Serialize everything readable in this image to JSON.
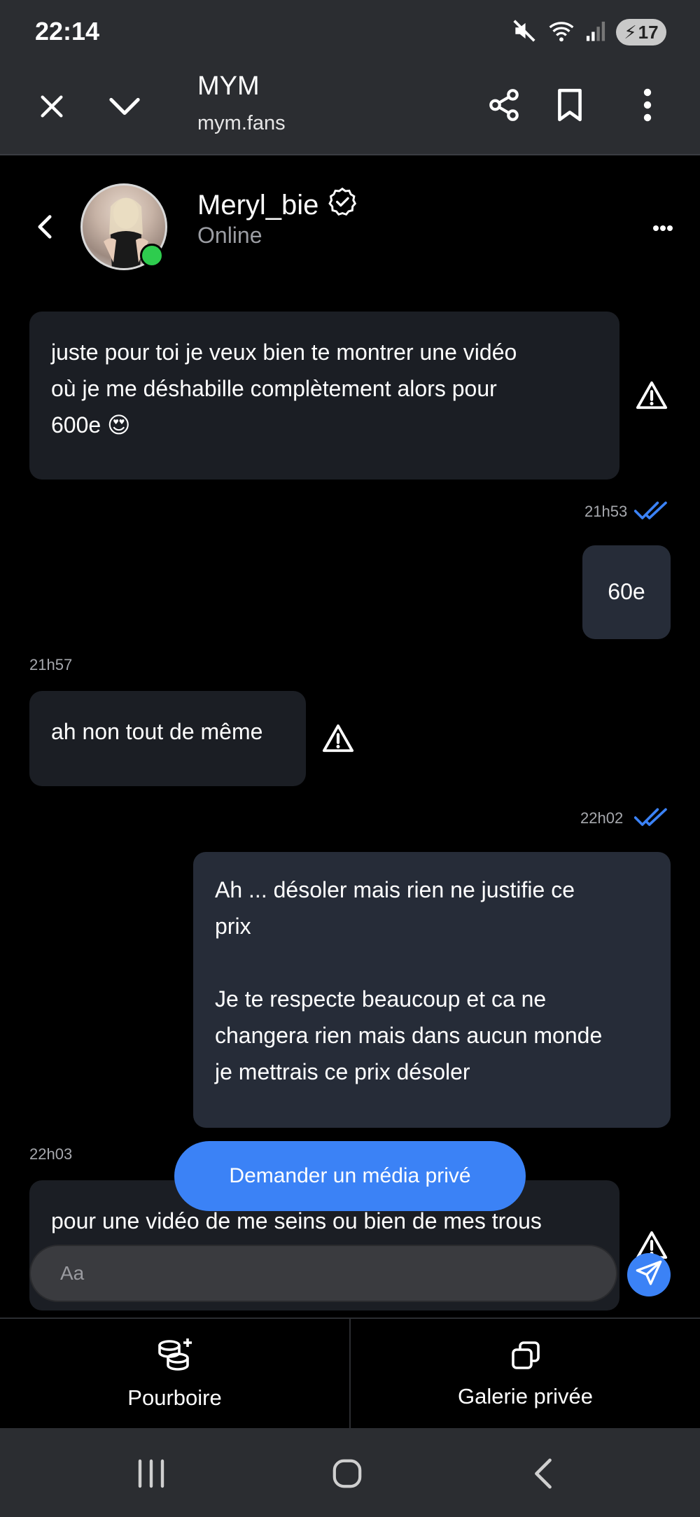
{
  "status_bar": {
    "time": "22:14",
    "battery": "17"
  },
  "browser": {
    "title": "MYM",
    "url": "mym.fans"
  },
  "chat": {
    "username": "Meryl_bie",
    "presence": "Online"
  },
  "messages": [
    {
      "from": "creator",
      "text_lines": [
        "juste pour toi je veux bien te montrer une vidéo",
        "où je me déshabille complètement alors pour",
        "600e 😍"
      ]
    },
    {
      "from": "me",
      "time": "21h53",
      "text_lines": [
        "60e"
      ]
    },
    {
      "from": "creator",
      "time": "21h57",
      "text_lines": [
        "ah non tout de même"
      ]
    },
    {
      "from": "me",
      "time": "22h02",
      "text_lines": [
        "Ah ... désoler mais rien ne justifie ce",
        "prix",
        "",
        "Je te respecte beaucoup et ca ne",
        "changera rien mais dans aucun monde",
        "je mettrais ce prix désoler"
      ]
    },
    {
      "from": "creator",
      "time": "22h03",
      "text_lines": [
        "pour une vidéo de me seins ou bien de mes trous"
      ]
    }
  ],
  "private_media_button": "Demander un média privé",
  "composer": {
    "placeholder": "Aa"
  },
  "bottom_tabs": [
    {
      "label": "Pourboire",
      "icon": "coins-plus-icon"
    },
    {
      "label": "Galerie privée",
      "icon": "gallery-icon"
    }
  ],
  "colors": {
    "accent": "#3b82f6",
    "online": "#2ecc4e",
    "bubble_in": "#1b1e24",
    "bubble_out": "#262c38"
  }
}
